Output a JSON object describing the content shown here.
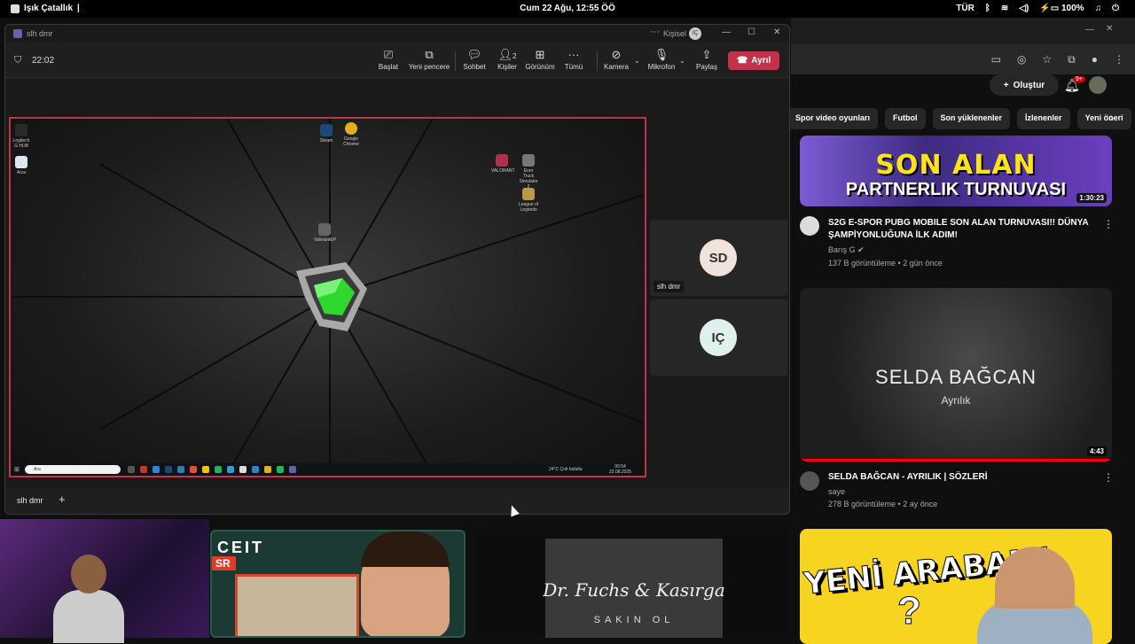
{
  "system_bar": {
    "app_name": "Işık Çatallık",
    "datetime": "Cum 22 Ağu, 12:55 ÖÖ",
    "lang": "TÜR",
    "battery": "100%"
  },
  "teams": {
    "title": "slh dmr",
    "account_label": "Kişisel",
    "account_initials": "IÇ",
    "timer": "22:02",
    "toolbar": {
      "start": "Başlat",
      "new_window": "Yeni pencere",
      "chat": "Sohbet",
      "people": "Kişiler",
      "people_count": "2",
      "view": "Görünüm",
      "more": "Tümü",
      "camera": "Kamera",
      "mic": "Mikrofon",
      "share": "Paylaş",
      "leave": "Ayrıl"
    },
    "participants": [
      {
        "initials": "SD",
        "name": "slh dmr",
        "color": "#f1e3dc"
      },
      {
        "initials": "IÇ",
        "name": "",
        "color": "#dff1ec"
      }
    ],
    "tab_label": "slh dmr"
  },
  "shared_screen": {
    "desktop_icons": [
      {
        "label": "Logitech G HUB",
        "color": "#2a2a2a"
      },
      {
        "label": "Acıa",
        "color": "#dde6f5"
      },
      {
        "label": "Steam",
        "color": "#1b4a7a"
      },
      {
        "label": "Google Chrome",
        "color": "#e0b020"
      },
      {
        "label": "VALORANT",
        "color": "#b0304a"
      },
      {
        "label": "Euro Truck Simulator 2",
        "color": "#777"
      },
      {
        "label": "League of Legends",
        "color": "#b89a4a"
      },
      {
        "label": "ValorantEP",
        "color": "#666"
      }
    ],
    "taskbar": {
      "search_placeholder": "Ara",
      "weather": "24°C Çok bulutlu",
      "time": "00:54",
      "date": "22.08.2025"
    }
  },
  "youtube": {
    "create_label": "Oluştur",
    "notif_badge": "9+",
    "chips": [
      "Spor video oyunları",
      "Futbol",
      "Son yüklenenler",
      "İzlenenler",
      "Yeni öneri"
    ],
    "videos": [
      {
        "thumb_line1": "SON ALAN",
        "thumb_line2": "PARTNERLIK TURNUVASI",
        "duration": "1:30:23",
        "title": "S2G E-SPOR PUBG MOBILE SON ALAN TURNUVASI!! DÜNYA ŞAMPİYONLUĞUNA İLK ADIM!",
        "channel": "Barış G",
        "verified": "✔",
        "stats": "137 B görüntüleme • 2 gün önce"
      },
      {
        "thumb_line1": "SELDA BAĞCAN",
        "thumb_line2": "Ayrılık",
        "duration": "4:43",
        "title": "SELDA BAĞCAN - AYRILIK | SÖZLERİ",
        "channel": "saye",
        "stats": "278 B görüntüleme • 2 ay önce"
      },
      {
        "thumb_line1": "YENİ ARABAM!",
        "thumb_line2": "?"
      }
    ],
    "bottom_thumbs": [
      {
        "text1": "CEIT",
        "text2": "SR"
      },
      {
        "text1": "Dr. Fuchs & Kasırga",
        "text2": "SAKIN OL"
      }
    ]
  }
}
